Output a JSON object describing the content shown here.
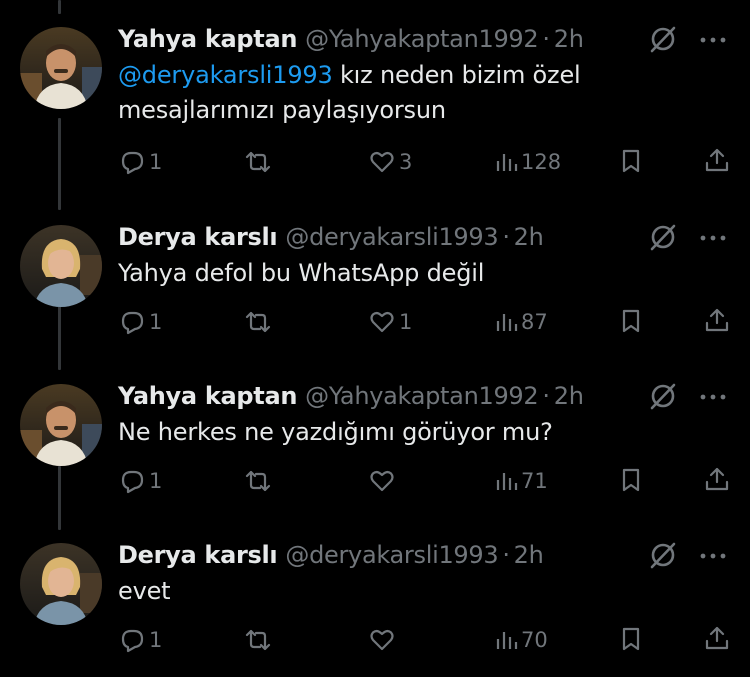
{
  "colors": {
    "background": "#000000",
    "text_primary": "#e7e9ea",
    "text_secondary": "#71767b",
    "mention": "#1d9bf0",
    "thread_line": "#333639"
  },
  "icons": {
    "reply": "reply-icon",
    "repost": "repost-icon",
    "like": "heart-icon",
    "views": "views-chart-icon",
    "bookmark": "bookmark-icon",
    "share": "share-icon",
    "grok": "grok-icon",
    "more": "more-icon"
  },
  "tweets": [
    {
      "name": "Yahya kaptan",
      "handle": "@Yahyakaptan1992",
      "separator": "·",
      "time": "2h",
      "mention": "@deryakarsli1993",
      "text": " kız neden bizim özel mesajlarımızı paylaşıyorsun",
      "replies": "1",
      "reposts": "",
      "likes": "3",
      "views": "128"
    },
    {
      "name": "Derya karslı",
      "handle": "@deryakarsli1993",
      "separator": "·",
      "time": "2h",
      "mention": "",
      "text": "Yahya defol bu WhatsApp değil",
      "replies": "1",
      "reposts": "",
      "likes": "1",
      "views": "87"
    },
    {
      "name": "Yahya kaptan",
      "handle": "@Yahyakaptan1992",
      "separator": "·",
      "time": "2h",
      "mention": "",
      "text": "Ne herkes ne yazdığımı görüyor mu?",
      "replies": "1",
      "reposts": "",
      "likes": "",
      "views": "71"
    },
    {
      "name": "Derya karslı",
      "handle": "@deryakarsli1993",
      "separator": "·",
      "time": "2h",
      "mention": "",
      "text": "evet",
      "replies": "1",
      "reposts": "",
      "likes": "",
      "views": "70"
    }
  ]
}
